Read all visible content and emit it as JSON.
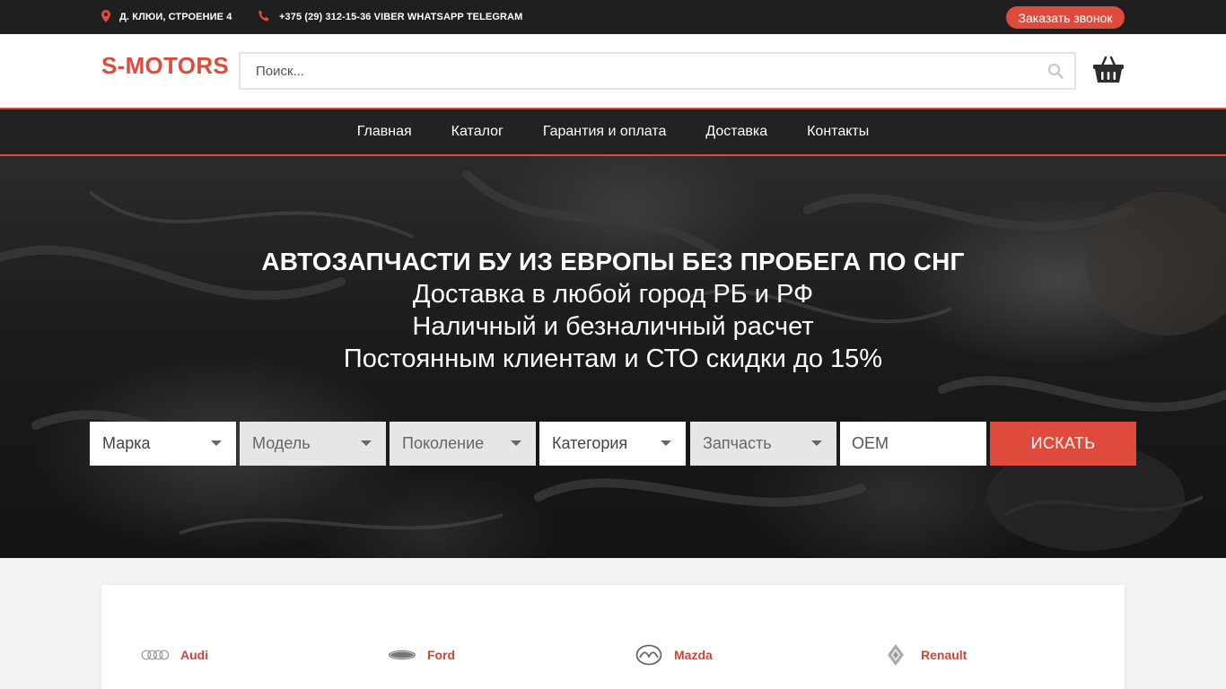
{
  "topbar": {
    "address": "Д. КЛЮИ, СТРОЕНИЕ 4",
    "phone": "+375 (29) 312-15-36 VIBER WHATSAPP TELEGRAM",
    "callback_label": "Заказать звонок",
    "address_icon": "map-pin-icon",
    "phone_icon": "phone-icon"
  },
  "header": {
    "logo": "S-MOTORS",
    "search_placeholder": "Поиск...",
    "search_icon": "search-icon",
    "cart_icon": "basket-icon"
  },
  "nav": {
    "items": [
      {
        "label": "Главная"
      },
      {
        "label": "Каталог"
      },
      {
        "label": "Гарантия и оплата"
      },
      {
        "label": "Доставка"
      },
      {
        "label": "Контакты"
      }
    ]
  },
  "hero": {
    "title": "АВТОЗАПЧАСТИ БУ ИЗ ЕВРОПЫ БЕЗ ПРОБЕГА ПО СНГ",
    "line1": "Доставка в любой город РБ и РФ",
    "line2": "Наличный и безналичный расчет",
    "line3": "Постоянным клиентам и СТО скидки до 15%"
  },
  "filters": {
    "make": "Марка",
    "model": "Модель",
    "generation": "Поколение",
    "category": "Категория",
    "part": "Запчасть",
    "oem_placeholder": "OEM",
    "search_label": "ИСКАТЬ"
  },
  "brands": [
    {
      "name": "Audi",
      "icon": "audi-logo-icon"
    },
    {
      "name": "Ford",
      "icon": "ford-logo-icon"
    },
    {
      "name": "Mazda",
      "icon": "mazda-logo-icon"
    },
    {
      "name": "Renault",
      "icon": "renault-logo-icon"
    }
  ],
  "colors": {
    "accent": "#de4a3b",
    "dark": "#1f1f1f",
    "brand_text": "#c9473a"
  }
}
